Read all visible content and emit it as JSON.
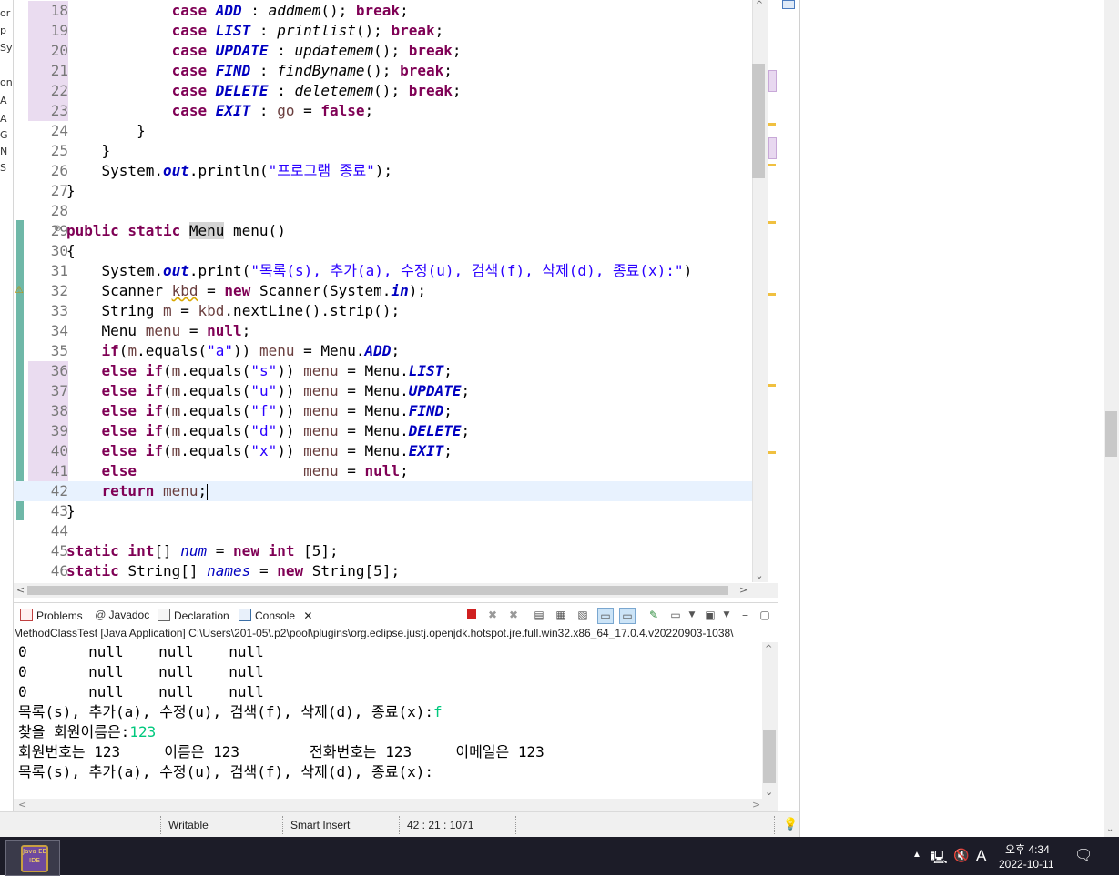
{
  "left_outline": {
    "fragments": [
      "or",
      "p",
      "Sy",
      "on",
      "A",
      "A",
      "G",
      "N",
      "S"
    ]
  },
  "editor": {
    "lines": [
      {
        "num": "18",
        "segments": [
          [
            "",
            "            "
          ],
          [
            "kw",
            "case "
          ],
          [
            "fi",
            "ADD"
          ],
          [
            "",
            " : "
          ],
          [
            "it",
            "addmem"
          ],
          [
            "",
            "(); "
          ],
          [
            "kw",
            "break"
          ],
          [
            "",
            ";"
          ]
        ]
      },
      {
        "num": "19",
        "segments": [
          [
            "",
            "            "
          ],
          [
            "kw",
            "case "
          ],
          [
            "fi",
            "LIST"
          ],
          [
            "",
            " : "
          ],
          [
            "it",
            "printlist"
          ],
          [
            "",
            "(); "
          ],
          [
            "kw",
            "break"
          ],
          [
            "",
            ";"
          ]
        ]
      },
      {
        "num": "20",
        "segments": [
          [
            "",
            "            "
          ],
          [
            "kw",
            "case "
          ],
          [
            "fi",
            "UPDATE"
          ],
          [
            "",
            " : "
          ],
          [
            "it",
            "updatemem"
          ],
          [
            "",
            "(); "
          ],
          [
            "kw",
            "break"
          ],
          [
            "",
            ";"
          ]
        ]
      },
      {
        "num": "21",
        "segments": [
          [
            "",
            "            "
          ],
          [
            "kw",
            "case "
          ],
          [
            "fi",
            "FIND"
          ],
          [
            "",
            " : "
          ],
          [
            "it",
            "findByname"
          ],
          [
            "",
            "(); "
          ],
          [
            "kw",
            "break"
          ],
          [
            "",
            ";"
          ]
        ]
      },
      {
        "num": "22",
        "segments": [
          [
            "",
            "            "
          ],
          [
            "kw",
            "case "
          ],
          [
            "fi",
            "DELETE"
          ],
          [
            "",
            " : "
          ],
          [
            "it",
            "deletemem"
          ],
          [
            "",
            "(); "
          ],
          [
            "kw",
            "break"
          ],
          [
            "",
            ";"
          ]
        ]
      },
      {
        "num": "23",
        "segments": [
          [
            "",
            "            "
          ],
          [
            "kw",
            "case "
          ],
          [
            "fi",
            "EXIT"
          ],
          [
            "",
            " : "
          ],
          [
            "lv",
            "go"
          ],
          [
            "",
            " = "
          ],
          [
            "kw",
            "false"
          ],
          [
            "",
            ";"
          ]
        ]
      },
      {
        "num": "24",
        "segments": [
          [
            "",
            "        }"
          ]
        ]
      },
      {
        "num": "25",
        "segments": [
          [
            "",
            "    }"
          ]
        ]
      },
      {
        "num": "26",
        "segments": [
          [
            "",
            "    System."
          ],
          [
            "fi",
            "out"
          ],
          [
            "",
            ".println("
          ],
          [
            "st",
            "\"프로그램 종료\""
          ],
          [
            "",
            ");"
          ]
        ]
      },
      {
        "num": "27",
        "segments": [
          [
            "",
            "}"
          ]
        ]
      },
      {
        "num": "28",
        "segments": [
          [
            "",
            ""
          ]
        ]
      },
      {
        "num": "29",
        "segments": [
          [
            "kw",
            "public static "
          ],
          [
            "ty",
            "Menu"
          ],
          [
            "",
            " menu()"
          ]
        ]
      },
      {
        "num": "30",
        "segments": [
          [
            "",
            "{"
          ]
        ]
      },
      {
        "num": "31",
        "segments": [
          [
            "",
            "    System."
          ],
          [
            "fi",
            "out"
          ],
          [
            "",
            ".print("
          ],
          [
            "st",
            "\"목록(s), 추가(a), 수정(u), 검색(f), 삭제(d), 종료(x):\""
          ],
          [
            "",
            ")"
          ]
        ]
      },
      {
        "num": "32",
        "segments": [
          [
            "",
            "    Scanner "
          ],
          [
            "lvw",
            "kbd"
          ],
          [
            "",
            " = "
          ],
          [
            "kw",
            "new "
          ],
          [
            "",
            "Scanner(System."
          ],
          [
            "fi",
            "in"
          ],
          [
            "",
            ");"
          ]
        ]
      },
      {
        "num": "33",
        "segments": [
          [
            "",
            "    String "
          ],
          [
            "lv",
            "m"
          ],
          [
            "",
            " = "
          ],
          [
            "lv",
            "kbd"
          ],
          [
            "",
            ".nextLine().strip();"
          ]
        ]
      },
      {
        "num": "34",
        "segments": [
          [
            "",
            "    Menu "
          ],
          [
            "lv",
            "menu"
          ],
          [
            "",
            " = "
          ],
          [
            "kw",
            "null"
          ],
          [
            "",
            ";"
          ]
        ]
      },
      {
        "num": "35",
        "segments": [
          [
            "",
            "    "
          ],
          [
            "kw",
            "if"
          ],
          [
            "",
            "("
          ],
          [
            "lv",
            "m"
          ],
          [
            "",
            ".equals("
          ],
          [
            "st",
            "\"a\""
          ],
          [
            "",
            ")) "
          ],
          [
            "lv",
            "menu"
          ],
          [
            "",
            " = Menu."
          ],
          [
            "fi",
            "ADD"
          ],
          [
            "",
            ";"
          ]
        ]
      },
      {
        "num": "36",
        "segments": [
          [
            "",
            "    "
          ],
          [
            "kw",
            "else if"
          ],
          [
            "",
            "("
          ],
          [
            "lv",
            "m"
          ],
          [
            "",
            ".equals("
          ],
          [
            "st",
            "\"s\""
          ],
          [
            "",
            ")) "
          ],
          [
            "lv",
            "menu"
          ],
          [
            "",
            " = Menu."
          ],
          [
            "fi",
            "LIST"
          ],
          [
            "",
            ";"
          ]
        ]
      },
      {
        "num": "37",
        "segments": [
          [
            "",
            "    "
          ],
          [
            "kw",
            "else if"
          ],
          [
            "",
            "("
          ],
          [
            "lv",
            "m"
          ],
          [
            "",
            ".equals("
          ],
          [
            "st",
            "\"u\""
          ],
          [
            "",
            ")) "
          ],
          [
            "lv",
            "menu"
          ],
          [
            "",
            " = Menu."
          ],
          [
            "fi",
            "UPDATE"
          ],
          [
            "",
            ";"
          ]
        ]
      },
      {
        "num": "38",
        "segments": [
          [
            "",
            "    "
          ],
          [
            "kw",
            "else if"
          ],
          [
            "",
            "("
          ],
          [
            "lv",
            "m"
          ],
          [
            "",
            ".equals("
          ],
          [
            "st",
            "\"f\""
          ],
          [
            "",
            ")) "
          ],
          [
            "lv",
            "menu"
          ],
          [
            "",
            " = Menu."
          ],
          [
            "fi",
            "FIND"
          ],
          [
            "",
            ";"
          ]
        ]
      },
      {
        "num": "39",
        "segments": [
          [
            "",
            "    "
          ],
          [
            "kw",
            "else if"
          ],
          [
            "",
            "("
          ],
          [
            "lv",
            "m"
          ],
          [
            "",
            ".equals("
          ],
          [
            "st",
            "\"d\""
          ],
          [
            "",
            ")) "
          ],
          [
            "lv",
            "menu"
          ],
          [
            "",
            " = Menu."
          ],
          [
            "fi",
            "DELETE"
          ],
          [
            "",
            ";"
          ]
        ]
      },
      {
        "num": "40",
        "segments": [
          [
            "",
            "    "
          ],
          [
            "kw",
            "else if"
          ],
          [
            "",
            "("
          ],
          [
            "lv",
            "m"
          ],
          [
            "",
            ".equals("
          ],
          [
            "st",
            "\"x\""
          ],
          [
            "",
            ")) "
          ],
          [
            "lv",
            "menu"
          ],
          [
            "",
            " = Menu."
          ],
          [
            "fi",
            "EXIT"
          ],
          [
            "",
            ";"
          ]
        ]
      },
      {
        "num": "41",
        "segments": [
          [
            "",
            "    "
          ],
          [
            "kw",
            "else"
          ],
          [
            "",
            "                   "
          ],
          [
            "lv",
            "menu"
          ],
          [
            "",
            " = "
          ],
          [
            "kw",
            "null"
          ],
          [
            "",
            ";"
          ]
        ]
      },
      {
        "num": "42",
        "segments": [
          [
            "",
            "    "
          ],
          [
            "kw",
            "return "
          ],
          [
            "lv",
            "menu"
          ],
          [
            "",
            ";"
          ]
        ]
      },
      {
        "num": "43",
        "segments": [
          [
            "",
            "}"
          ]
        ]
      },
      {
        "num": "44",
        "segments": [
          [
            "",
            ""
          ]
        ]
      },
      {
        "num": "45",
        "segments": [
          [
            "kw",
            "static int"
          ],
          [
            "",
            "[] "
          ],
          [
            "fv",
            "num"
          ],
          [
            "",
            " = "
          ],
          [
            "kw",
            "new int "
          ],
          [
            "",
            "[5];"
          ]
        ]
      },
      {
        "num": "46",
        "segments": [
          [
            "kw",
            "static "
          ],
          [
            "",
            "String[] "
          ],
          [
            "fv",
            "names"
          ],
          [
            "",
            " = "
          ],
          [
            "kw",
            "new "
          ],
          [
            "",
            "String[5];"
          ]
        ]
      }
    ]
  },
  "console": {
    "tabs": [
      "Problems",
      "Javadoc",
      "Declaration",
      "Console"
    ],
    "header": "MethodClassTest [Java Application] C:\\Users\\201-05\\.p2\\pool\\plugins\\org.eclipse.justj.openjdk.hotspot.jre.full.win32.x86_64_17.0.4.v20220903-1038\\",
    "lines": [
      {
        "text": "0       null    null    null",
        "input": ""
      },
      {
        "text": "0       null    null    null",
        "input": ""
      },
      {
        "text": "0       null    null    null",
        "input": ""
      },
      {
        "text": "목록(s), 추가(a), 수정(u), 검색(f), 삭제(d), 종료(x):",
        "input": "f"
      },
      {
        "text": "찾을 회원이름은:",
        "input": "123"
      },
      {
        "text": "회원번호는 123     이름은 123        전화번호는 123     이메일은 123",
        "input": ""
      },
      {
        "text": "목록(s), 추가(a), 수정(u), 검색(f), 삭제(d), 종료(x):",
        "input": ""
      }
    ]
  },
  "status_bar": {
    "writable": "Writable",
    "insert_mode": "Smart Insert",
    "position": "42 : 21 : 1071"
  },
  "taskbar": {
    "app_label": "Java EE IDE",
    "ime": "A",
    "time": "오후 4:34",
    "date": "2022-10-11"
  },
  "colors": {
    "keyword": "#7f0055",
    "string": "#2a00ff",
    "field": "#0000c0",
    "local_var": "#6a3e3e",
    "console_input": "#00c87d",
    "current_line": "#e8f2fe"
  }
}
